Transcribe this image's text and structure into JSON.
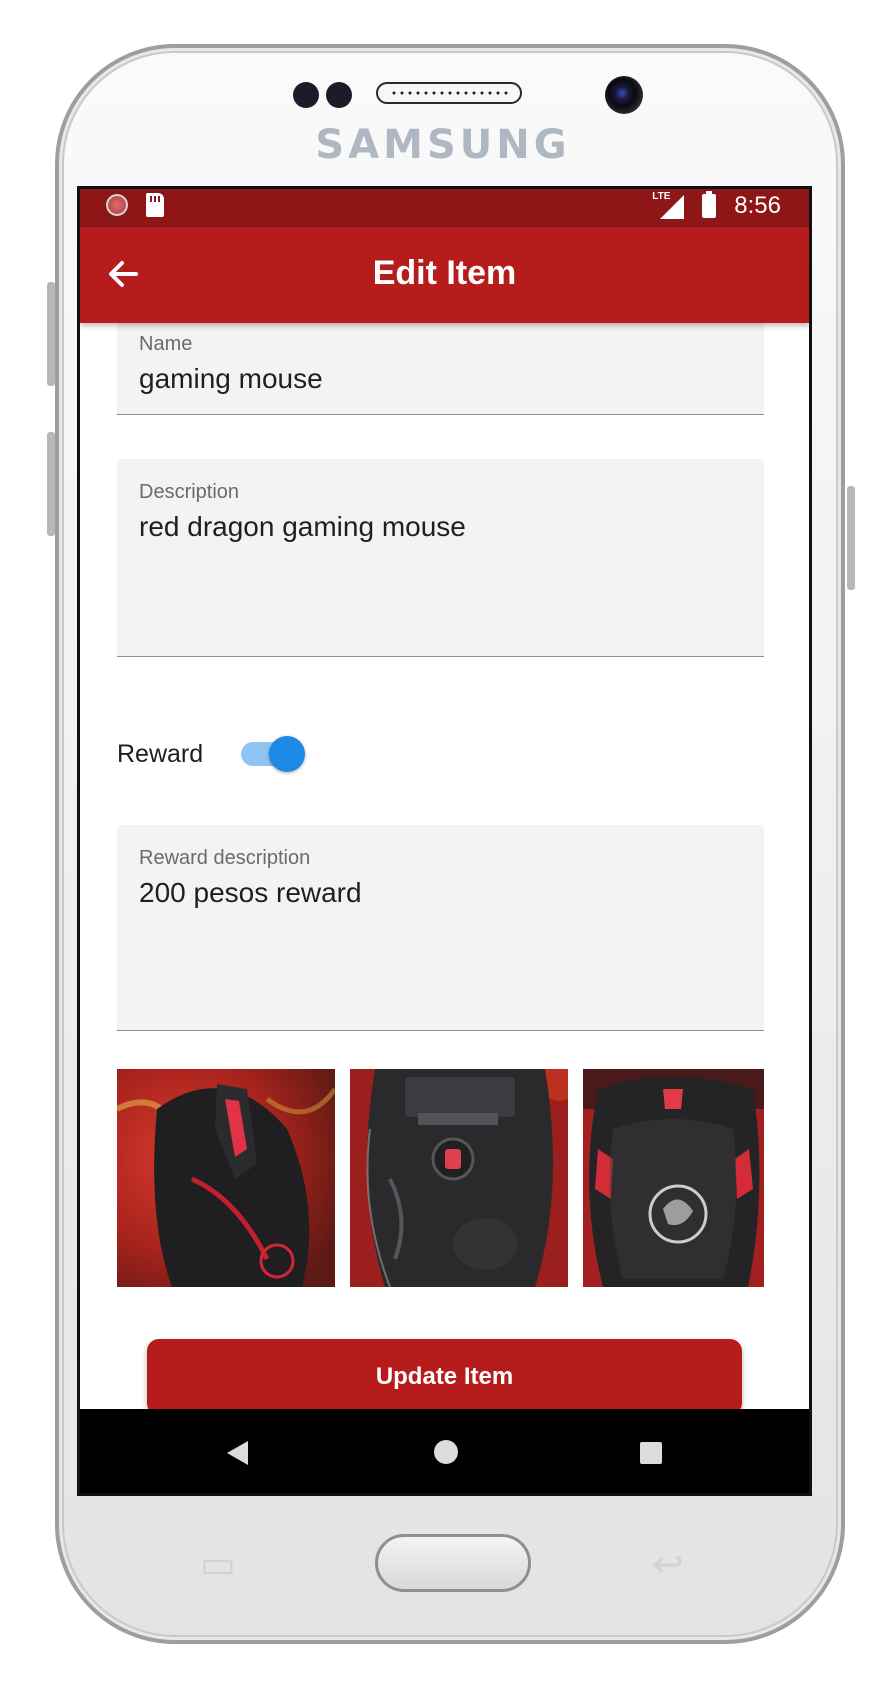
{
  "device": {
    "brand": "SAMSUNG"
  },
  "status_bar": {
    "time": "8:56",
    "network": "LTE",
    "left_icons": [
      "notification-icon",
      "sd-card-icon"
    ],
    "background_color": "#8e1617"
  },
  "app_bar": {
    "title": "Edit Item",
    "back_icon": "arrow-back-icon",
    "background_color": "#b71c1c"
  },
  "form": {
    "name": {
      "label": "Name",
      "value": "gaming mouse"
    },
    "description": {
      "label": "Description",
      "value": "red dragon gaming mouse"
    },
    "reward": {
      "label": "Reward",
      "enabled": true,
      "accent_color": "#1e88e5"
    },
    "reward_description": {
      "label": "Reward description",
      "value": "200 pesos reward"
    },
    "photos": [
      {
        "subject": "mouse-top-photo"
      },
      {
        "subject": "mouse-bottom-photo"
      },
      {
        "subject": "mouse-back-photo"
      }
    ],
    "submit_label": "Update Item"
  },
  "nav_bar": {
    "buttons": [
      "nav-back-icon",
      "nav-home-icon",
      "nav-recents-icon"
    ]
  }
}
